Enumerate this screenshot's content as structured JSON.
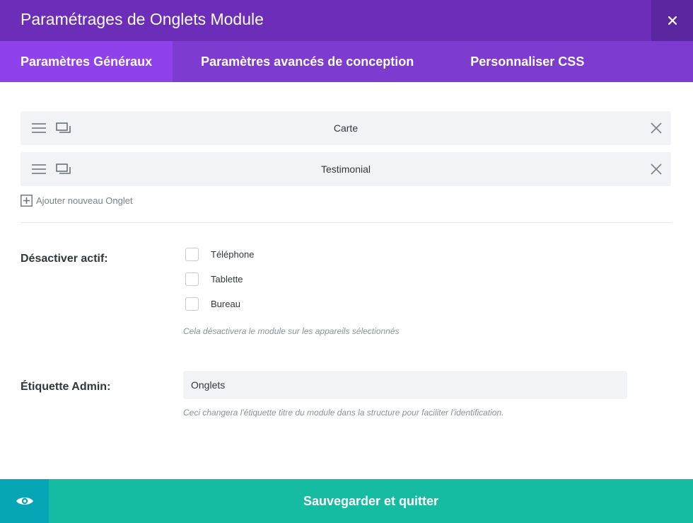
{
  "header": {
    "title": "Paramétrages de Onglets Module",
    "close_icon": "close-icon"
  },
  "tabs": [
    {
      "label": "Paramètres Généraux",
      "active": true
    },
    {
      "label": "Paramètres avancés de conception",
      "active": false
    },
    {
      "label": "Personnaliser CSS",
      "active": false
    }
  ],
  "items": [
    {
      "label": "Carte"
    },
    {
      "label": "Testimonial"
    }
  ],
  "add_tab": {
    "label": "Ajouter nouveau Onglet"
  },
  "disable": {
    "label": "Désactiver actif:",
    "options": [
      {
        "label": "Téléphone",
        "checked": false
      },
      {
        "label": "Tablette",
        "checked": false
      },
      {
        "label": "Bureau",
        "checked": false
      }
    ],
    "help": "Cela désactivera le module sur les appareils sélectionnés"
  },
  "admin_label": {
    "label": "Étiquette Admin:",
    "value": "Onglets",
    "help": "Ceci changera l'étiquette titre du module dans la structure pour faciliter l'identification."
  },
  "footer": {
    "save_label": "Sauvegarder et quitter",
    "preview_icon": "eye-icon"
  },
  "colors": {
    "header": "#6c2eb9",
    "tabs": "#7e3bd0",
    "active_tab": "#8f42ec",
    "save": "#16bca1",
    "preview": "#06a6b7"
  }
}
